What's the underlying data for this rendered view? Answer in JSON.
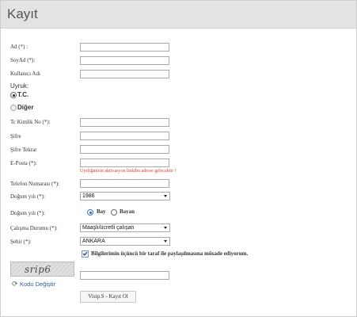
{
  "header": {
    "title": "Kayıt"
  },
  "form": {
    "ad_label": "Ad (*) :",
    "soyad_label": "SoyAd (*):",
    "username_label": "Kullanıcı Adı",
    "uyruk_label": "Uyruk:",
    "uyruk_tc": "T.C.",
    "uyruk_diger": "Diğer",
    "tc_label": "Tc Kimlik No (*):",
    "sifre_label": "Şifre",
    "sifre_tekrar_label": "Şifre Tekrar",
    "eposta_label": "E-Posta (*):",
    "eposta_hint": "Uyeliğinizin aktivasyon linkibu adrese gelecektir !",
    "telefon_label": "Telefon Numarası (*):",
    "dogum_yili_label": "Doğum yılı (*):",
    "dogum_yili_value": "1986",
    "cinsiyet_label": "Doğum yılı (*):",
    "cinsiyet_bay": "Bay",
    "cinsiyet_bayan": "Bayan",
    "calisma_label": "Çalışma Durumu (*):",
    "calisma_value": "Maaşlı/ücretli çalışan",
    "sehir_label": "Şehir (*):",
    "sehir_value": "ANKARA",
    "consent_text": "Bilgilerimin üçüncü bir taraf ile paylaşılmasına müsade ediyorum.",
    "captcha_text": "srip6",
    "refresh_label": "Kodu Değiştir",
    "submit_label": "Visip.S - Kayıt Ol"
  }
}
